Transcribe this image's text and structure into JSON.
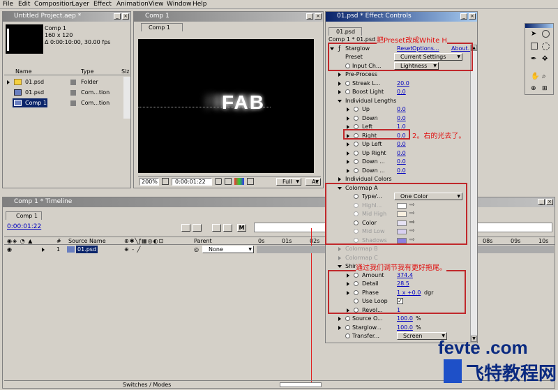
{
  "menu": [
    "File",
    "Edit",
    "Composition",
    "Layer",
    "Effect",
    "Animation",
    "View",
    "Window",
    "Help"
  ],
  "project": {
    "title": "Untitled Project.aep *",
    "comp_name": "Comp 1",
    "comp_size": "160 x 120",
    "comp_dur": "Δ 0:00:10:00, 30.00 fps",
    "col_name": "Name",
    "col_type": "Type",
    "col_size": "Siz",
    "items": [
      {
        "name": "01.psd",
        "type": "Folder"
      },
      {
        "name": "01.psd",
        "type": "Com...tion"
      },
      {
        "name": "Comp 1",
        "type": "Com...tion"
      }
    ]
  },
  "comp": {
    "title": "Comp 1",
    "tab": "Comp 1",
    "text": "FAB",
    "zoom": "200%",
    "time": "0:00:01:22",
    "res": "Full",
    "cam": "Ac"
  },
  "effect": {
    "title": "01.psd * Effect Controls",
    "tab": "01.psd",
    "breadcrumb": "Comp 1 * 01.psd",
    "starglow": "Starglow",
    "reset": "Reset",
    "options": "Options...",
    "about": "About...",
    "preset_label": "Preset",
    "preset_val": "Current Settings",
    "input_label": "Input Ch...",
    "input_val": "Lightness",
    "preprocess": "Pre-Process",
    "streak_label": "Streak L...",
    "streak_val": "20.0",
    "boost_label": "Boost Light",
    "boost_val": "0.0",
    "indiv_lengths": "Individual Lengths",
    "up": "Up",
    "up_val": "0.0",
    "down": "Down",
    "down_val": "0.0",
    "left": "Left",
    "left_val": "1.0",
    "right": "Right",
    "right_val": "0.0",
    "upleft": "Up Left",
    "upleft_val": "0.0",
    "upright": "Up Right",
    "upright_val": "0.0",
    "down1": "Down ...",
    "down1_val": "0.0",
    "down2": "Down ...",
    "down2_val": "0.0",
    "indiv_colors": "Individual Colors",
    "colormap_a": "Colormap A",
    "type_label": "Type/...",
    "type_val": "One Color",
    "highlights": "Highl...",
    "mid_high": "Mid High",
    "color": "Color",
    "mid_low": "Mid Low",
    "shadows": "Shadows",
    "colormap_b": "Colormap B",
    "colormap_c": "Colormap C",
    "shimmer": "Shimmer",
    "amount": "Amount",
    "amount_val": "374.4",
    "detail": "Detail",
    "detail_val": "28.5",
    "phase": "Phase",
    "phase_val": "1 x +0.0",
    "phase_unit": "dgr",
    "use_loop": "Use Loop",
    "revol": "Revol...",
    "revol_val": "1",
    "source_o": "Source O...",
    "source_o_val": "100.0",
    "source_o_unit": "%",
    "starglow_o": "Starglow...",
    "starglow_o_val": "100.0",
    "starglow_o_unit": "%",
    "transfer": "Transfer...",
    "transfer_val": "Screen"
  },
  "annot": {
    "a1": "把Preset改成White H",
    "a2": "2。右的光去了。",
    "a3": "通过我们调节我有更好拖尾。"
  },
  "timeline": {
    "title": "Comp 1 * Timeline",
    "tab": "Comp 1",
    "time": "0:00:01:22",
    "col_num": "#",
    "col_source": "Source Name",
    "col_parent": "Parent",
    "layer_num": "1",
    "layer_name": "01.psd",
    "parent_val": "None",
    "ruler": [
      "0s",
      "01s",
      "02s"
    ],
    "ruler_right": [
      "08s",
      "09s",
      "10s"
    ],
    "switches": "Switches / Modes"
  },
  "watermark": {
    "line1": "fevte .com",
    "line2": "飞特教程网"
  },
  "colors": {
    "titlebar_active": "#0a246a",
    "annot_red": "#c0282b",
    "link_blue": "#0000c0",
    "color_swatch": "#e6e2f4",
    "shadow_swatch": "#8a80e0"
  }
}
